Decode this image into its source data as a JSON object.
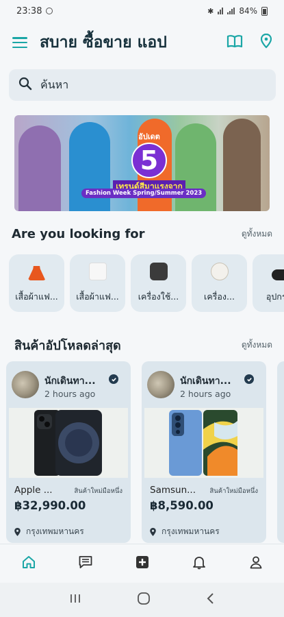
{
  "status": {
    "time": "23:38",
    "battery": "84%"
  },
  "app": {
    "title": "สบาย ซื้อขาย แอป"
  },
  "search": {
    "placeholder": "ค้นหา"
  },
  "banner": {
    "line1": "อัปเดต",
    "number": "5",
    "line2": "เทรนด์สีมาแรงจาก",
    "line3": "Fashion Week Spring/Summer 2023"
  },
  "categories_section": {
    "title": "Are you looking for",
    "see_all": "ดูทั้งหมด",
    "items": [
      {
        "label": "เสื้อผ้าแฟ...",
        "color": "#e8571e"
      },
      {
        "label": "เสื้อผ้าแฟ...",
        "color": "#f2f2f2"
      },
      {
        "label": "เครื่องใช้...",
        "color": "#3b3b3b"
      },
      {
        "label": "เครื่อง...",
        "color": "#f3f1ec"
      },
      {
        "label": "อุปกรณ",
        "color": "#222222"
      }
    ]
  },
  "latest_section": {
    "title": "สินค้าอัปโหลดล่าสุด",
    "see_all": "ดูทั้งหมด",
    "products": [
      {
        "seller": "นักเดินทา...",
        "time": "2 hours ago",
        "name": "Apple ...",
        "condition": "สินค้าใหม่มือหนึ่ง",
        "price": "฿32,990.00",
        "location": "กรุงเทพมหานคร"
      },
      {
        "seller": "นักเดินทา...",
        "time": "2 hours ago",
        "name": "Samsun...",
        "condition": "สินค้าใหม่มือหนึ่ง",
        "price": "฿8,590.00",
        "location": "กรุงเทพมหานคร"
      }
    ]
  },
  "colors": {
    "accent": "#1aa6a6",
    "dark": "#18323d"
  }
}
